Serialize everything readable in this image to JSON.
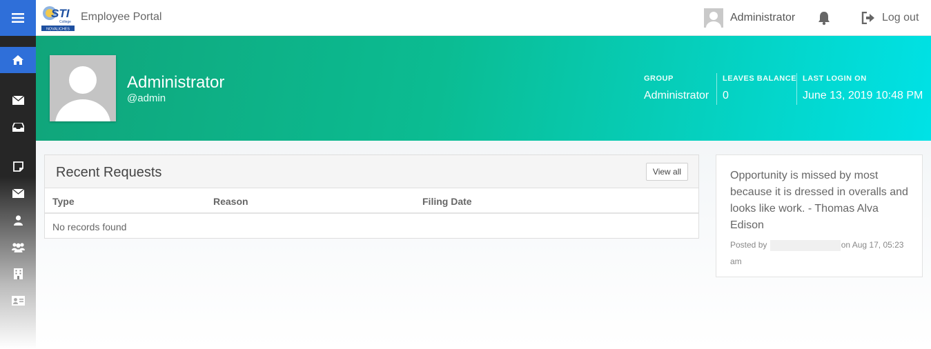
{
  "header": {
    "app_title": "Employee Portal",
    "user_name": "Administrator",
    "logout_label": "Log out",
    "logo_text": "STI",
    "logo_subtext": "College",
    "logo_campus": "NOVALICHES"
  },
  "sidebar": {
    "items": [
      {
        "icon": "home-icon",
        "active": true
      },
      {
        "icon": "envelope-icon"
      },
      {
        "icon": "inbox-icon"
      },
      {
        "icon": "note-icon"
      },
      {
        "icon": "mail-icon"
      },
      {
        "icon": "user-icon"
      },
      {
        "icon": "users-icon"
      },
      {
        "icon": "building-icon"
      },
      {
        "icon": "id-card-icon"
      }
    ]
  },
  "profile": {
    "name": "Administrator",
    "handle": "@admin",
    "stats": [
      {
        "label": "Group",
        "value": "Administrator"
      },
      {
        "label": "Leaves Balance",
        "value": "0"
      },
      {
        "label": "Last Login On",
        "value": "June 13, 2019 10:48 PM"
      }
    ]
  },
  "recent_requests": {
    "title": "Recent Requests",
    "view_all_label": "View all",
    "columns": [
      "Type",
      "Reason",
      "Filing Date"
    ],
    "empty_text": "No records found"
  },
  "quote": {
    "text": "Opportunity is missed by most because it is dressed in overalls and looks like work. - Thomas Alva Edison",
    "posted_by_prefix": "Posted by",
    "posted_on": "on Aug 17, 05:23 am"
  },
  "colors": {
    "accent": "#2f6fd9",
    "header_gradient_start": "#10a57a",
    "header_gradient_end": "#00e2e6",
    "sidebar_dark": "#262626"
  }
}
